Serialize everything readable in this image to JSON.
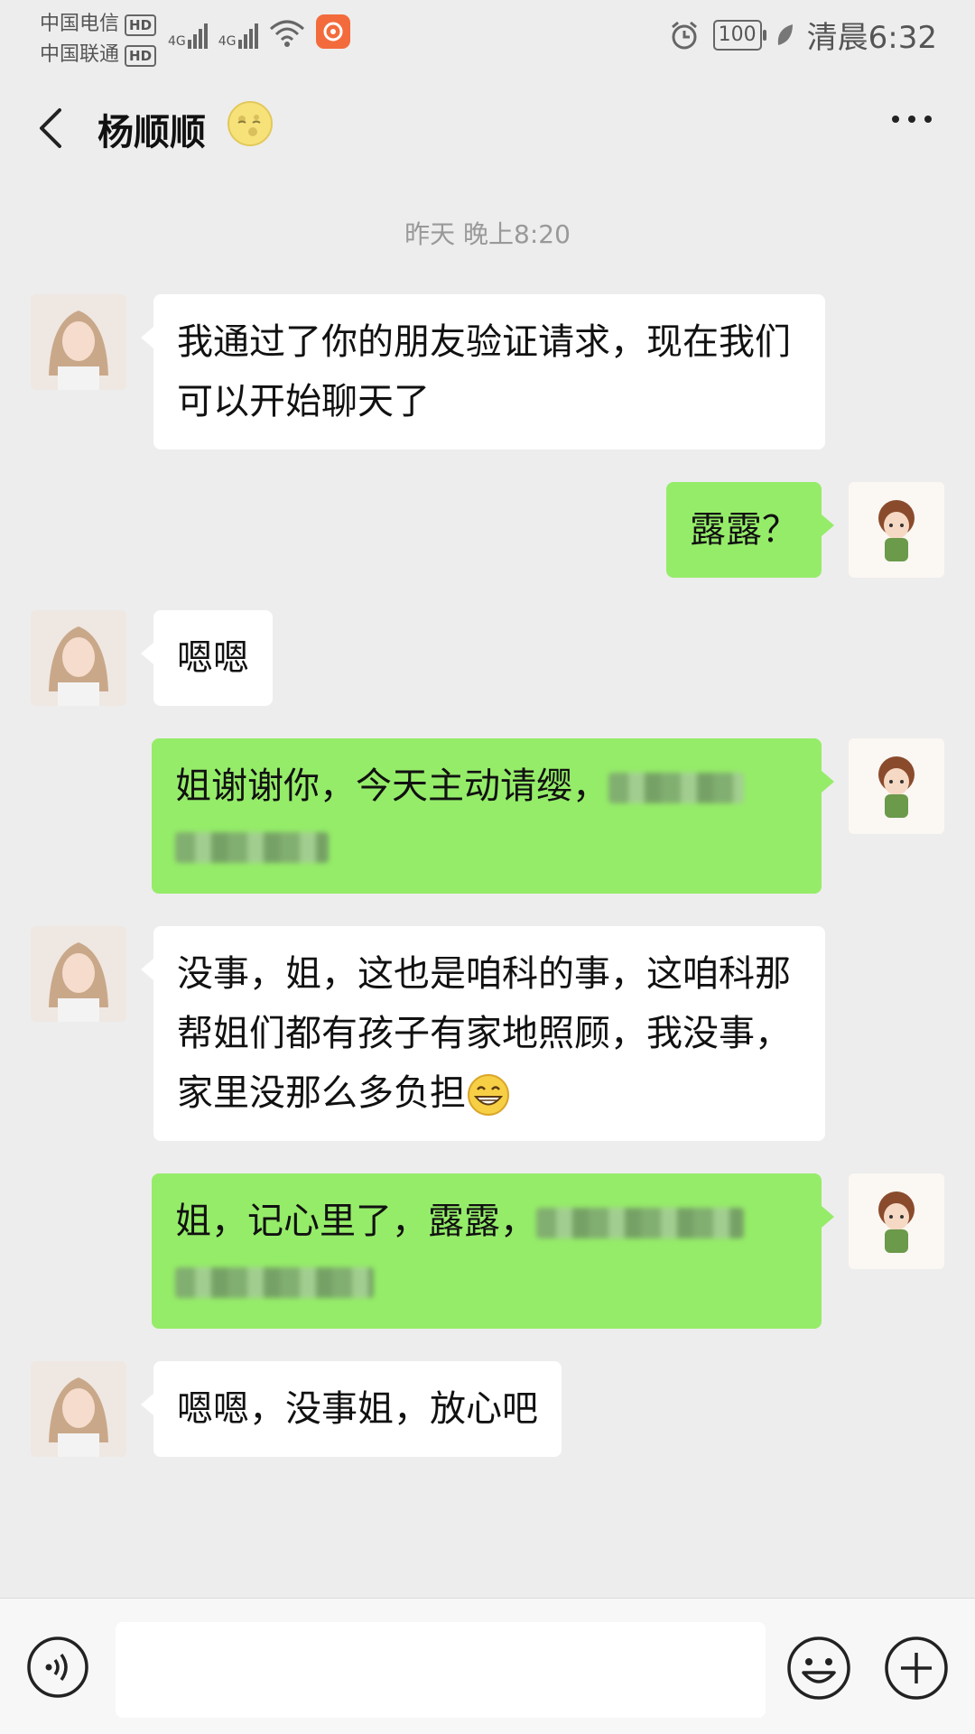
{
  "status_bar": {
    "carrier_1": "中国电信",
    "carrier_2": "中国联通",
    "hd_label": "HD",
    "network_1": "4G",
    "network_2": "4G",
    "battery": "100",
    "time": "清晨6:32"
  },
  "header": {
    "contact_name": "杨顺顺",
    "name_icon": "moon-face-icon"
  },
  "timestamp": "昨天 晚上8:20",
  "messages": [
    {
      "side": "left",
      "text": "我通过了你的朋友验证请求，现在我们可以开始聊天了"
    },
    {
      "side": "right",
      "text": "露露？"
    },
    {
      "side": "left",
      "text": "嗯嗯"
    },
    {
      "side": "right",
      "text": "姐谢谢你，今天主动请缨，",
      "redacted": true
    },
    {
      "side": "left",
      "text": "没事，姐，这也是咱科的事，这咱科那帮姐们都有孩子有家地照顾，我没事，家里没那么多负担",
      "emoji": "grinning-face-icon"
    },
    {
      "side": "right",
      "text": "姐，记心里了，露露，",
      "redacted": true
    },
    {
      "side": "left",
      "text": "嗯嗯，没事姐，放心吧"
    }
  ],
  "colors": {
    "background": "#ededed",
    "sent_bubble": "#95ec69",
    "received_bubble": "#ffffff"
  }
}
